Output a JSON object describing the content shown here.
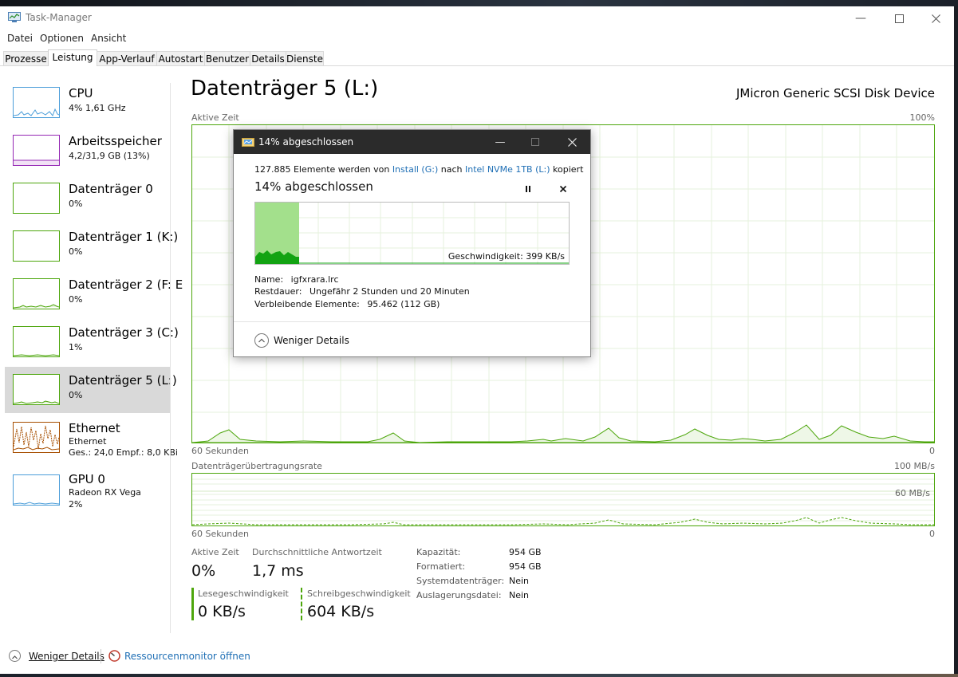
{
  "window": {
    "title": "Task-Manager"
  },
  "menu": [
    "Datei",
    "Optionen",
    "Ansicht"
  ],
  "tabs": [
    "Prozesse",
    "Leistung",
    "App-Verlauf",
    "Autostart",
    "Benutzer",
    "Details",
    "Dienste"
  ],
  "active_tab": "Leistung",
  "sidebar": {
    "items": [
      {
        "title": "CPU",
        "sub1": "4% 1,61 GHz",
        "sub2": "",
        "sub3": "",
        "color": "#4c9ed9"
      },
      {
        "title": "Arbeitsspeicher",
        "sub1": "4,2/31,9 GB (13%)",
        "sub2": "",
        "sub3": "",
        "color": "#9528b4"
      },
      {
        "title": "Datenträger 0",
        "sub1": "0%",
        "sub2": "",
        "sub3": "",
        "color": "#4da60c"
      },
      {
        "title": "Datenträger 1 (K:)",
        "sub1": "0%",
        "sub2": "",
        "sub3": "",
        "color": "#4da60c"
      },
      {
        "title": "Datenträger 2 (F: E",
        "sub1": "0%",
        "sub2": "",
        "sub3": "",
        "color": "#4da60c"
      },
      {
        "title": "Datenträger 3 (C:)",
        "sub1": "1%",
        "sub2": "",
        "sub3": "",
        "color": "#4da60c"
      },
      {
        "title": "Datenträger 5 (L:)",
        "sub1": "0%",
        "sub2": "",
        "sub3": "",
        "color": "#4da60c"
      },
      {
        "title": "Ethernet",
        "sub1": "Ethernet",
        "sub2": "Ges.: 24,0  Empf.: 8,0 KBi",
        "sub3": "",
        "color": "#a74f01"
      },
      {
        "title": "GPU 0",
        "sub1": "Radeon RX Vega",
        "sub2": "2%",
        "sub3": "",
        "color": "#4c9ed9"
      }
    ],
    "selected_index": 6
  },
  "main": {
    "title": "Datenträger 5 (L:)",
    "device": "JMicron Generic SCSI Disk Device",
    "graph1": {
      "label": "Aktive Zeit",
      "max_label": "100%",
      "time_label": "60 Sekunden",
      "min_label": "0"
    },
    "graph2": {
      "label": "Datenträgerübertragungsrate",
      "max_label": "100 MB/s",
      "mid_label": "60 MB/s",
      "time_label": "60 Sekunden",
      "min_label": "0"
    },
    "stats": {
      "active_time_label": "Aktive Zeit",
      "active_time_value": "0%",
      "response_label": "Durchschnittliche Antwortzeit",
      "response_value": "1,7 ms",
      "read_label": "Lesegeschwindigkeit",
      "read_value": "0 KB/s",
      "write_label": "Schreibgeschwindigkeit",
      "write_value": "604 KB/s"
    },
    "properties": [
      {
        "key": "Kapazität:",
        "value": "954 GB"
      },
      {
        "key": "Formatiert:",
        "value": "954 GB"
      },
      {
        "key": "Systemdatenträger:",
        "value": "Nein"
      },
      {
        "key": "Auslagerungsdatei:",
        "value": "Nein"
      }
    ]
  },
  "footer": {
    "fewer_details": "Weniger Details",
    "resource_monitor": "Ressourcenmonitor öffnen"
  },
  "copy_dialog": {
    "title": "14% abgeschlossen",
    "line_prefix": "127.885 Elemente werden von ",
    "source": "Install (G:)",
    "line_mid": " nach ",
    "target": "Intel NVMe 1TB (L:)",
    "line_suffix": " kopiert",
    "heading": "14% abgeschlossen",
    "progress_percent": 14,
    "speed": "Geschwindigkeit: 399 KB/s",
    "name_key": "Name:",
    "name_val": "igfxrara.lrc",
    "remaining_time_key": "Restdauer:",
    "remaining_time_val": "Ungefähr 2 Stunden und 20 Minuten",
    "remaining_items_key": "Verbleibende Elemente:",
    "remaining_items_val": "95.462 (112 GB)",
    "fewer_details": "Weniger Details"
  },
  "colors": {
    "disk": "#4da60c",
    "cpu": "#4c9ed9",
    "memory": "#9528b4",
    "ethernet": "#a74f01",
    "dialog_title_bg": "#2b2b2b",
    "link": "#1f6fb5"
  }
}
